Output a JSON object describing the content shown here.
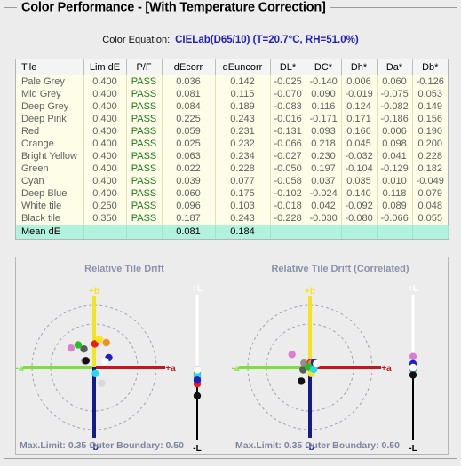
{
  "window": {
    "groupbox_title": "Color Performance - [With Temperature Correction]"
  },
  "equation": {
    "label": "Color Equation:",
    "value": "CIELab(D65/10) (T=20.7°C, RH=51.0%)",
    "value_color": "#2020c0"
  },
  "table": {
    "columns": [
      "Tile",
      "Lim dE",
      "P/F",
      "dEcorr",
      "dEuncorr",
      "DL*",
      "DC*",
      "Dh*",
      "Da*",
      "Db*"
    ],
    "rows": [
      {
        "tile": "Pale Grey",
        "lim": "0.400",
        "pf": "PASS",
        "dEcorr": "0.036",
        "dEuncorr": "0.142",
        "DL": "-0.025",
        "DC": "-0.140",
        "Dh": "0.006",
        "Da": "0.060",
        "Db": "-0.126",
        "swatch": "#d9d9d9"
      },
      {
        "tile": "Mid Grey",
        "lim": "0.400",
        "pf": "PASS",
        "dEcorr": "0.081",
        "dEuncorr": "0.115",
        "DL": "-0.070",
        "DC": "0.090",
        "Dh": "-0.019",
        "Da": "-0.075",
        "Db": "0.053",
        "swatch": "#909090"
      },
      {
        "tile": "Deep Grey",
        "lim": "0.400",
        "pf": "PASS",
        "dEcorr": "0.084",
        "dEuncorr": "0.189",
        "DL": "-0.083",
        "DC": "0.116",
        "Dh": "0.124",
        "Da": "-0.082",
        "Db": "0.149",
        "swatch": "#5a5a5a"
      },
      {
        "tile": "Deep Pink",
        "lim": "0.400",
        "pf": "PASS",
        "dEcorr": "0.225",
        "dEuncorr": "0.243",
        "DL": "-0.016",
        "DC": "-0.171",
        "Dh": "0.171",
        "Da": "-0.186",
        "Db": "0.156",
        "swatch": "#d97fd0"
      },
      {
        "tile": "Red",
        "lim": "0.400",
        "pf": "PASS",
        "dEcorr": "0.059",
        "dEuncorr": "0.231",
        "DL": "-0.131",
        "DC": "0.093",
        "Dh": "0.166",
        "Da": "0.006",
        "Db": "0.190",
        "swatch": "#e81d1d"
      },
      {
        "tile": "Orange",
        "lim": "0.400",
        "pf": "PASS",
        "dEcorr": "0.025",
        "dEuncorr": "0.232",
        "DL": "-0.066",
        "DC": "0.218",
        "Dh": "0.045",
        "Da": "0.098",
        "Db": "0.200",
        "swatch": "#f0901e"
      },
      {
        "tile": "Bright Yellow",
        "lim": "0.400",
        "pf": "PASS",
        "dEcorr": "0.063",
        "dEuncorr": "0.234",
        "DL": "-0.027",
        "DC": "0.230",
        "Dh": "-0.032",
        "Da": "0.041",
        "Db": "0.228",
        "swatch": "#f2e61c"
      },
      {
        "tile": "Green",
        "lim": "0.400",
        "pf": "PASS",
        "dEcorr": "0.022",
        "dEuncorr": "0.228",
        "DL": "-0.050",
        "DC": "0.197",
        "Dh": "-0.104",
        "Da": "-0.129",
        "Db": "0.182",
        "swatch": "#22c222"
      },
      {
        "tile": "Cyan",
        "lim": "0.400",
        "pf": "PASS",
        "dEcorr": "0.039",
        "dEuncorr": "0.077",
        "DL": "-0.058",
        "DC": "0.037",
        "Dh": "0.035",
        "Da": "0.010",
        "Db": "-0.049",
        "swatch": "#22dced"
      },
      {
        "tile": "Deep Blue",
        "lim": "0.400",
        "pf": "PASS",
        "dEcorr": "0.060",
        "dEuncorr": "0.175",
        "DL": "-0.102",
        "DC": "-0.024",
        "Dh": "0.140",
        "Da": "0.118",
        "Db": "0.079",
        "swatch": "#1a22c4"
      },
      {
        "tile": "White tile",
        "lim": "0.250",
        "pf": "PASS",
        "dEcorr": "0.096",
        "dEuncorr": "0.103",
        "DL": "-0.018",
        "DC": "0.042",
        "Dh": "-0.092",
        "Da": "0.089",
        "Db": "0.048",
        "swatch": "#fafafa"
      },
      {
        "tile": "Black tile",
        "lim": "0.350",
        "pf": "PASS",
        "dEcorr": "0.187",
        "dEuncorr": "0.243",
        "DL": "-0.228",
        "DC": "-0.030",
        "Dh": "-0.080",
        "Da": "-0.066",
        "Db": "0.055",
        "swatch": "#111111"
      }
    ],
    "mean_row": {
      "label": "Mean dE",
      "dEcorr": "0.081",
      "dEuncorr": "0.184"
    }
  },
  "charts": {
    "axis_labels": {
      "plus_b": "+b",
      "minus_b": "-b",
      "plus_a": "+a",
      "minus_a": "-a",
      "plus_L": "+L",
      "minus_L": "-L"
    },
    "left": {
      "title": "Relative Tile Drift",
      "footer": "Max.Limit: 0.35  Outer Boundary: 0.50",
      "max_limit": 0.35,
      "outer_boundary": 0.5
    },
    "right": {
      "title": "Relative Tile Drift (Correlated)",
      "footer": "Max.Limit: 0.35  Outer Boundary: 0.50",
      "max_limit": 0.35,
      "outer_boundary": 0.5
    }
  },
  "chart_data": [
    {
      "type": "scatter",
      "title": "Relative Tile Drift",
      "xlabel": "a*",
      "ylabel": "b*",
      "xlim": [
        -0.5,
        0.5
      ],
      "ylim": [
        -0.5,
        0.5
      ],
      "grid": true,
      "grid_rings": [
        0.35,
        0.5
      ],
      "annotations": [
        "Max.Limit: 0.35",
        "Outer Boundary: 0.50"
      ],
      "legend": "none",
      "points": [
        {
          "name": "Pale Grey",
          "color": "#d9d9d9",
          "a": 0.06,
          "b": -0.126,
          "L": -0.025
        },
        {
          "name": "Mid Grey",
          "color": "#909090",
          "a": -0.075,
          "b": 0.053,
          "L": -0.07
        },
        {
          "name": "Deep Grey",
          "color": "#5a5a5a",
          "a": -0.082,
          "b": 0.149,
          "L": -0.083
        },
        {
          "name": "Deep Pink",
          "color": "#d97fd0",
          "a": -0.186,
          "b": 0.156,
          "L": -0.016
        },
        {
          "name": "Red",
          "color": "#e81d1d",
          "a": 0.006,
          "b": 0.19,
          "L": -0.131
        },
        {
          "name": "Orange",
          "color": "#f0901e",
          "a": 0.098,
          "b": 0.2,
          "L": -0.066
        },
        {
          "name": "Bright Yellow",
          "color": "#f2e61c",
          "a": 0.041,
          "b": 0.228,
          "L": -0.027
        },
        {
          "name": "Green",
          "color": "#22c222",
          "a": -0.129,
          "b": 0.182,
          "L": -0.05
        },
        {
          "name": "Cyan",
          "color": "#22dced",
          "a": 0.01,
          "b": -0.049,
          "L": -0.058
        },
        {
          "name": "Deep Blue",
          "color": "#1a22c4",
          "a": 0.118,
          "b": 0.079,
          "L": -0.102
        },
        {
          "name": "White tile",
          "color": "#fafafa",
          "a": 0.089,
          "b": 0.048,
          "L": -0.018
        },
        {
          "name": "Black tile",
          "color": "#111111",
          "a": -0.066,
          "b": 0.055,
          "L": -0.228
        }
      ],
      "L_axis": {
        "label_top": "+L",
        "label_bottom": "-L",
        "range": [
          -0.5,
          0.5
        ]
      }
    },
    {
      "type": "scatter",
      "title": "Relative Tile Drift (Correlated)",
      "xlabel": "a*",
      "ylabel": "b*",
      "xlim": [
        -0.5,
        0.5
      ],
      "ylim": [
        -0.5,
        0.5
      ],
      "grid": true,
      "grid_rings": [
        0.35,
        0.5
      ],
      "annotations": [
        "Max.Limit: 0.35",
        "Outer Boundary: 0.50"
      ],
      "legend": "none",
      "points": [
        {
          "name": "Pale Grey",
          "color": "#d9d9d9",
          "a": 0.035,
          "b": 0.012,
          "L": -0.01
        },
        {
          "name": "Mid Grey",
          "color": "#909090",
          "a": -0.048,
          "b": 0.035,
          "L": -0.012
        },
        {
          "name": "Deep Grey",
          "color": "#5a5a5a",
          "a": -0.055,
          "b": -0.018,
          "L": -0.014
        },
        {
          "name": "Deep Pink",
          "color": "#d97fd0",
          "a": -0.145,
          "b": 0.105,
          "L": 0.088
        },
        {
          "name": "Red",
          "color": "#e81d1d",
          "a": 0.005,
          "b": 0.04,
          "L": -0.004
        },
        {
          "name": "Orange",
          "color": "#f0901e",
          "a": 0.012,
          "b": 0.03,
          "L": -0.005
        },
        {
          "name": "Bright Yellow",
          "color": "#f2e61c",
          "a": 0.01,
          "b": -0.048,
          "L": -0.006
        },
        {
          "name": "Green",
          "color": "#22c222",
          "a": -0.015,
          "b": 0.004,
          "L": -0.008
        },
        {
          "name": "Cyan",
          "color": "#22dced",
          "a": 0.03,
          "b": -0.014,
          "L": -0.007
        },
        {
          "name": "Deep Blue",
          "color": "#1a22c4",
          "a": 0.035,
          "b": 0.04,
          "L": 0.03
        },
        {
          "name": "White tile",
          "color": "#fafafa",
          "a": 0.052,
          "b": 0.03,
          "L": 0.0
        },
        {
          "name": "Black tile",
          "color": "#111111",
          "a": -0.07,
          "b": -0.11,
          "L": -0.06
        }
      ],
      "L_axis": {
        "label_top": "+L",
        "label_bottom": "-L",
        "range": [
          -0.5,
          0.5
        ]
      }
    }
  ]
}
